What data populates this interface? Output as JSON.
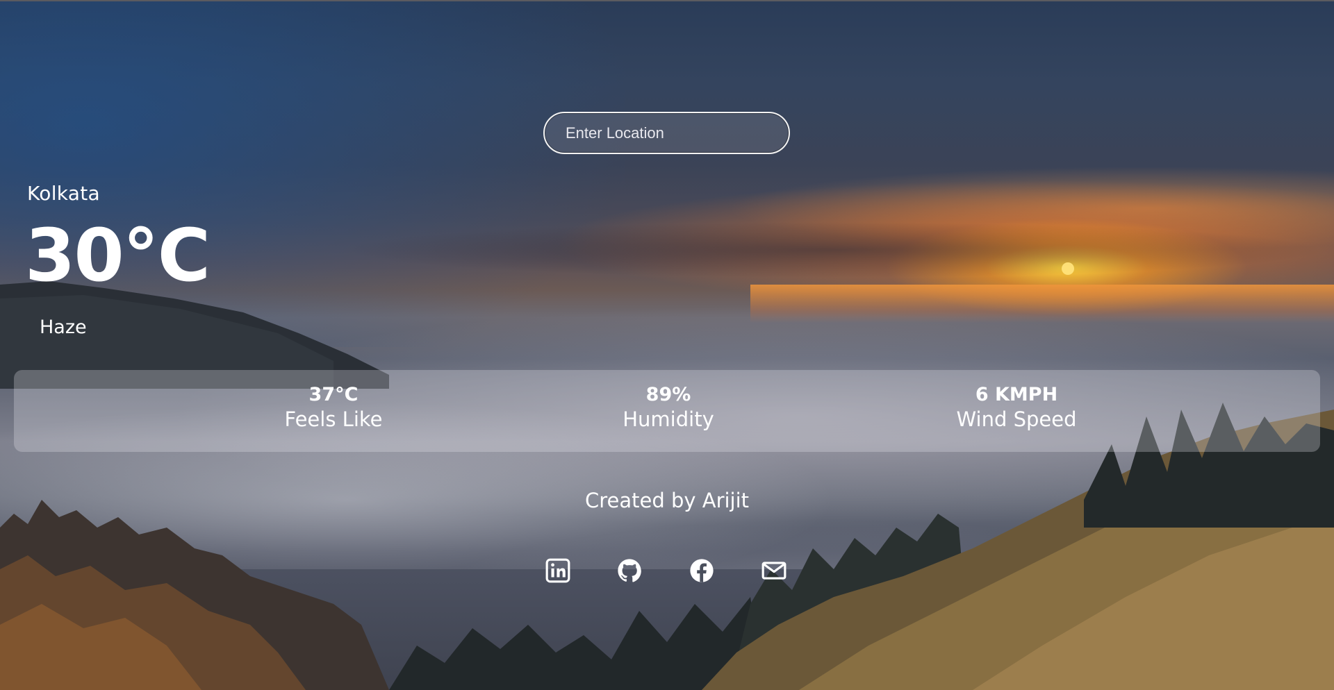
{
  "search": {
    "placeholder": "Enter Location",
    "value": ""
  },
  "current": {
    "city": "Kolkata",
    "temperature": "30°C",
    "condition": "Haze"
  },
  "stats": [
    {
      "value": "37°C",
      "label": "Feels Like"
    },
    {
      "value": "89%",
      "label": "Humidity"
    },
    {
      "value": "6 KMPH",
      "label": "Wind Speed"
    }
  ],
  "footer": {
    "credit": "Created by Arijit",
    "socials": [
      {
        "icon": "linkedin-icon"
      },
      {
        "icon": "github-icon"
      },
      {
        "icon": "facebook-icon"
      },
      {
        "icon": "mail-icon"
      }
    ]
  },
  "colors": {
    "text": "#ffffff",
    "panel": "rgba(235,235,240,0.28)",
    "sunset": "#f27a22"
  }
}
